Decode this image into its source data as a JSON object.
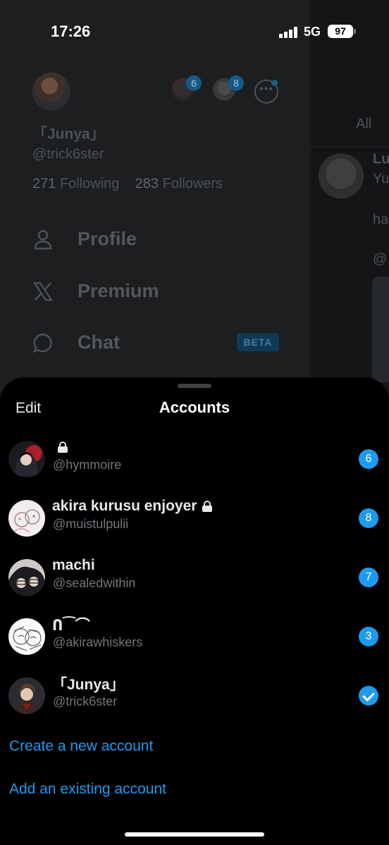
{
  "status": {
    "time": "17:26",
    "network": "5G",
    "battery": "97"
  },
  "drawer": {
    "mini_badges": [
      "6",
      "8"
    ],
    "name": "「Junya」",
    "handle": "@trick6ster",
    "following_count": "271",
    "following_label": "Following",
    "followers_count": "283",
    "followers_label": "Followers",
    "menu": {
      "profile": "Profile",
      "premium": "Premium",
      "chat": "Chat",
      "chat_badge": "BETA"
    }
  },
  "timeline": {
    "tab_all": "All",
    "fragments": [
      "Lu",
      "Yu",
      "ha",
      "@"
    ]
  },
  "sheet": {
    "edit_label": "Edit",
    "title": "Accounts",
    "accounts": [
      {
        "name": "",
        "handle": "@hymmoire",
        "badge": "6",
        "locked": true
      },
      {
        "name": "akira kurusu enjoyer",
        "handle": "@muistulpulii",
        "badge": "8",
        "locked": true
      },
      {
        "name": "machi",
        "handle": "@sealedwithin",
        "badge": "7",
        "locked": false
      },
      {
        "name": "Ո⁀⌒",
        "handle": "@akirawhiskers",
        "badge": "3",
        "locked": false
      },
      {
        "name": "「Junya」",
        "handle": "@trick6ster",
        "badge": "",
        "locked": false,
        "current": true
      }
    ],
    "create_label": "Create a new account",
    "add_label": "Add an existing account"
  }
}
